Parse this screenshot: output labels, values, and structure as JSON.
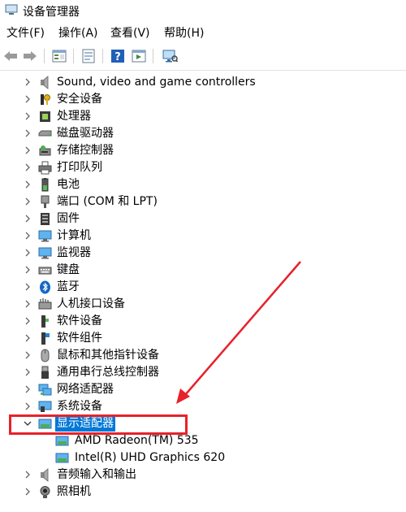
{
  "window": {
    "title": "设备管理器"
  },
  "menu": {
    "file": "文件(F)",
    "action": "操作(A)",
    "view": "查看(V)",
    "help": "帮助(H)"
  },
  "toolbar": {
    "buttons": [
      "back-icon",
      "forward-icon",
      "properties-icon",
      "update-driver-icon",
      "help-icon",
      "show-hidden-icon",
      "scan-hardware-icon"
    ]
  },
  "tree": {
    "items": [
      {
        "label": "Sound, video and game controllers",
        "icon": "speaker-icon"
      },
      {
        "label": "安全设备",
        "icon": "key-icon"
      },
      {
        "label": "处理器",
        "icon": "cpu-icon"
      },
      {
        "label": "磁盘驱动器",
        "icon": "disk-drive-icon"
      },
      {
        "label": "存储控制器",
        "icon": "storage-controller-icon"
      },
      {
        "label": "打印队列",
        "icon": "printer-icon"
      },
      {
        "label": "电池",
        "icon": "battery-icon"
      },
      {
        "label": "端口 (COM 和 LPT)",
        "icon": "port-icon"
      },
      {
        "label": "固件",
        "icon": "firmware-icon"
      },
      {
        "label": "计算机",
        "icon": "computer-icon"
      },
      {
        "label": "监视器",
        "icon": "monitor-icon"
      },
      {
        "label": "键盘",
        "icon": "keyboard-icon"
      },
      {
        "label": "蓝牙",
        "icon": "bluetooth-icon"
      },
      {
        "label": "人机接口设备",
        "icon": "hid-icon"
      },
      {
        "label": "软件设备",
        "icon": "software-device-icon"
      },
      {
        "label": "软件组件",
        "icon": "software-component-icon"
      },
      {
        "label": "鼠标和其他指针设备",
        "icon": "mouse-icon"
      },
      {
        "label": "通用串行总线控制器",
        "icon": "usb-icon"
      },
      {
        "label": "网络适配器",
        "icon": "network-adapter-icon"
      },
      {
        "label": "系统设备",
        "icon": "system-device-icon"
      },
      {
        "label": "显示适配器",
        "icon": "display-adapter-icon",
        "expanded": true,
        "selected": true
      },
      {
        "label": "AMD Radeon(TM) 535",
        "icon": "display-adapter-icon",
        "child": true
      },
      {
        "label": "Intel(R) UHD Graphics 620",
        "icon": "display-adapter-icon",
        "child": true
      },
      {
        "label": "音频输入和输出",
        "icon": "audio-io-icon"
      },
      {
        "label": "照相机",
        "icon": "camera-icon"
      }
    ]
  },
  "colors": {
    "selection": "#0078d7",
    "annotation": "#e8212a"
  }
}
